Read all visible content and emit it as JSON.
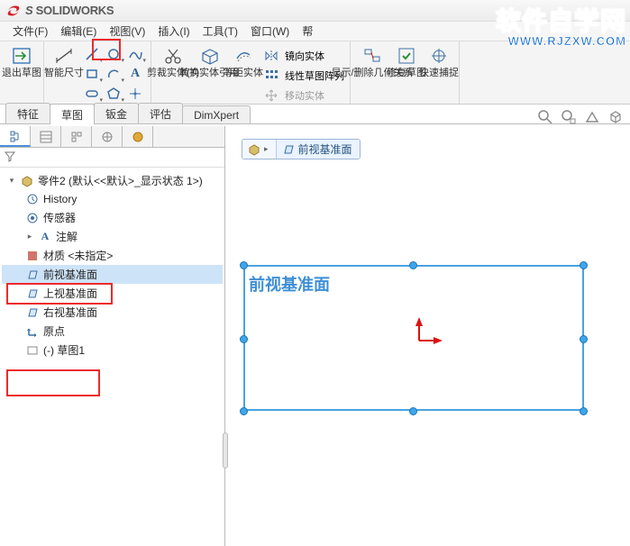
{
  "app": {
    "name": "SOLIDWORKS"
  },
  "menu": [
    "文件(F)",
    "编辑(E)",
    "视图(V)",
    "插入(I)",
    "工具(T)",
    "窗口(W)",
    "帮"
  ],
  "ribbon": {
    "exit_sketch": "退出草图",
    "smart_dim": "智能尺寸",
    "trim": "剪裁实体(T)",
    "convert": "转换实体引用",
    "offset": "等距实体",
    "mirror": "镜向实体",
    "linear_pattern": "线性草图阵列",
    "move": "移动实体",
    "show_hide": "显示/删除几何关系",
    "repair": "修复草图",
    "quick_capture": "快速捕捉"
  },
  "tabs": [
    "特征",
    "草图",
    "钣金",
    "评估",
    "DimXpert"
  ],
  "fm_tabs": [
    "config",
    "display",
    "property-mgr",
    "appearance",
    "custom"
  ],
  "tree": {
    "root": "零件2  (默认<<默认>_显示状态 1>)",
    "history": "History",
    "sensors": "传感器",
    "annotations": "注解",
    "material": "材质 <未指定>",
    "front_plane": "前视基准面",
    "top_plane": "上视基准面",
    "right_plane": "右视基准面",
    "origin": "原点",
    "sketch1": "(-) 草图1"
  },
  "breadcrumb": {
    "part_icon_label": "",
    "plane_label": "前视基准面"
  },
  "canvas": {
    "plane_label": "前视基准面"
  },
  "watermark": {
    "line1": "软件自学网",
    "line2": "WWW.RJZXW.COM"
  }
}
